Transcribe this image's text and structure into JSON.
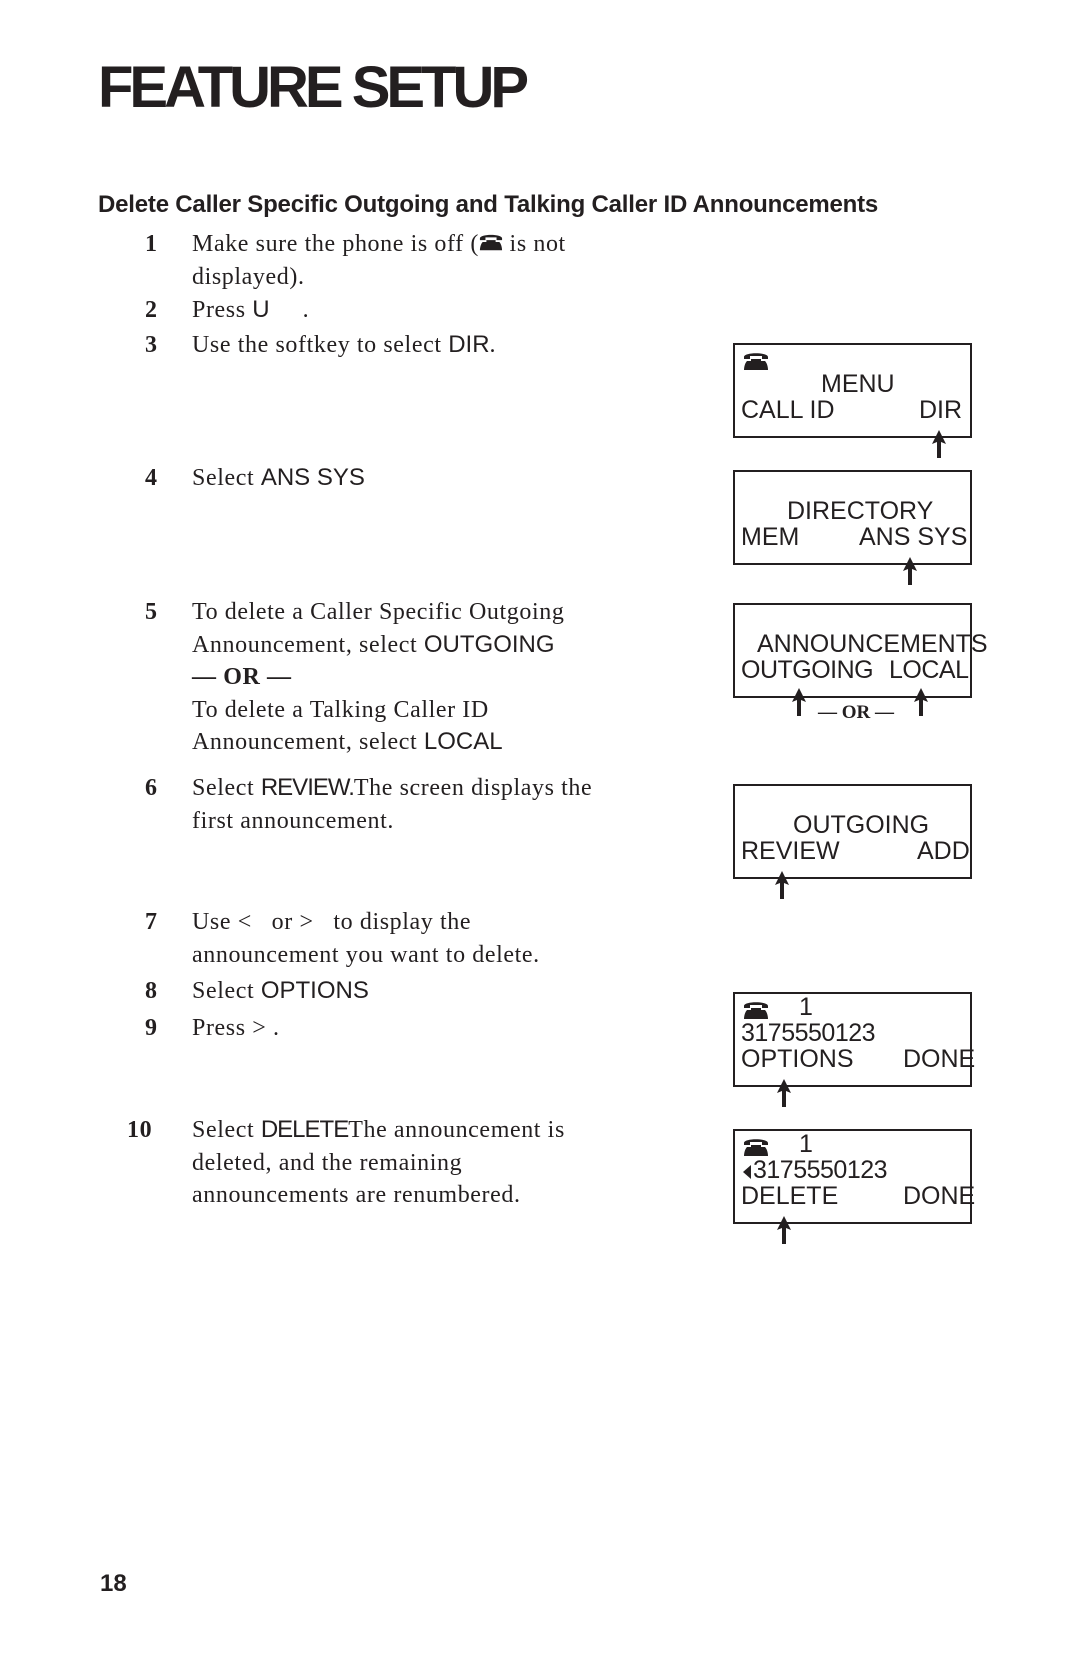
{
  "page": {
    "title": "FEATURE SETUP",
    "section_heading": "Delete Caller Specific Outgoing and Talking Caller ID Announcements",
    "page_number": "18"
  },
  "steps": [
    {
      "num": "1",
      "lines": [
        "Make sure the phone is off (",
        " is not",
        "displayed)."
      ],
      "icon": "phone-icon"
    },
    {
      "num": "2",
      "text_a": "Press ",
      "key": "U",
      "text_b": "     ."
    },
    {
      "num": "3",
      "text_a": "Use the softkey to select ",
      "key": "DIR",
      "text_b": "."
    },
    {
      "num": "4",
      "text_a": "Select ",
      "key": "ANS SYS"
    },
    {
      "num": "5",
      "line1": "To delete a Caller Specific Outgoing",
      "line2_a": "Announcement, select ",
      "line2_key": "OUTGOING",
      "or": "— OR —",
      "line3": "To delete a Talking Caller ID",
      "line4_a": "Announcement, select ",
      "line4_key": "LOCAL"
    },
    {
      "num": "6",
      "text_a": "Select ",
      "key": "REVIEW.",
      "text_b": "The screen displays the",
      "line2": "first announcement."
    },
    {
      "num": "7",
      "line1": "Use <   or >   to display the",
      "line2": "announcement you want to delete."
    },
    {
      "num": "8",
      "text_a": "Select ",
      "key": "OPTIONS"
    },
    {
      "num": "9",
      "text_a": "Press >  ."
    },
    {
      "num": "10",
      "text_a": "Select ",
      "key": "DELETE",
      "text_b": "The announcement is",
      "line2": "deleted, and the remaining",
      "line3": "announcements are renumbered."
    }
  ],
  "lcd_screens": [
    {
      "id": "menu",
      "show_phone": true,
      "line1": "MENU",
      "left": "CALL ID",
      "right": "DIR",
      "selected": "DIR"
    },
    {
      "id": "directory",
      "show_phone": false,
      "line1": "DIRECTORY",
      "left": "MEM",
      "right": "ANS SYS",
      "selected": "ANS SYS"
    },
    {
      "id": "announcements",
      "show_phone": false,
      "line1": "ANNOUNCEMENTS",
      "left": "OUTGOING",
      "right": "LOCAL",
      "selected": "OUTGOING or LOCAL",
      "or_label": "— OR —"
    },
    {
      "id": "outgoing",
      "show_phone": false,
      "line1": "OUTGOING",
      "left": "REVIEW",
      "right": "ADD",
      "selected": "REVIEW"
    },
    {
      "id": "options",
      "show_phone": true,
      "index": "1",
      "number": "3175550123",
      "left": "OPTIONS",
      "right": "DONE",
      "selected": "OPTIONS"
    },
    {
      "id": "delete",
      "show_phone": true,
      "index": "1",
      "number": "3175550123",
      "has_left_arrow": true,
      "left": "DELETE",
      "right": "DONE",
      "selected": "DELETE"
    }
  ]
}
